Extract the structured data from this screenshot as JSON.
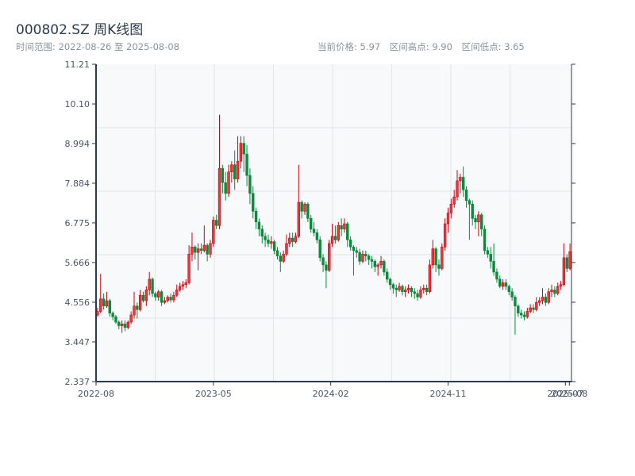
{
  "header": {
    "title": "000802.SZ 周K线图",
    "range_text": "时间范围: 2022-08-26 至 2025-08-08",
    "current_price": "当前价格: 5.97",
    "range_high": "区间高点: 9.90",
    "range_low": "区间低点: 3.65"
  },
  "colors": {
    "up": "#d0000f",
    "up_fill": "#e53a40",
    "down": "#0b8a3c",
    "axis": "#2c3a4b",
    "plot_bg": "#f7f9fb",
    "grid": "#e2e5ea"
  },
  "chart_data": {
    "type": "candlestick",
    "title": "000802.SZ 周K线图",
    "up_color": "red",
    "down_color": "green",
    "ylim": [
      2.337,
      11.21
    ],
    "y_ticks": [
      "11.21",
      "10.10",
      "8.994",
      "7.884",
      "6.775",
      "5.666",
      "4.556",
      "3.447",
      "2.337"
    ],
    "x_ticks": [
      {
        "label": "2022-08",
        "index": 0
      },
      {
        "label": "2023-05",
        "index": 38.5
      },
      {
        "label": "2024-02",
        "index": 77
      },
      {
        "label": "2024-11",
        "index": 115.5
      },
      {
        "label": "2025-07",
        "index": 154
      },
      {
        "label": "2025-08",
        "index": 155.3
      }
    ],
    "grid": true,
    "ohlc_fields": [
      "open",
      "close",
      "low",
      "high"
    ],
    "ohlc": [
      [
        4.2,
        4.3,
        4.15,
        4.4
      ],
      [
        4.3,
        4.65,
        4.25,
        5.35
      ],
      [
        4.65,
        4.45,
        4.35,
        4.8
      ],
      [
        4.45,
        4.6,
        4.4,
        4.85
      ],
      [
        4.6,
        4.25,
        4.15,
        4.65
      ],
      [
        4.25,
        4.15,
        4.05,
        4.3
      ],
      [
        4.15,
        4.0,
        3.95,
        4.2
      ],
      [
        4.0,
        3.9,
        3.8,
        4.05
      ],
      [
        3.9,
        3.95,
        3.7,
        4.05
      ],
      [
        3.95,
        3.85,
        3.75,
        4.05
      ],
      [
        3.85,
        4.0,
        3.8,
        4.05
      ],
      [
        4.0,
        4.2,
        3.95,
        4.3
      ],
      [
        4.2,
        4.45,
        4.1,
        4.85
      ],
      [
        4.45,
        4.35,
        4.1,
        4.55
      ],
      [
        4.35,
        4.75,
        4.3,
        4.9
      ],
      [
        4.75,
        4.6,
        4.55,
        4.85
      ],
      [
        4.6,
        4.9,
        4.45,
        5.0
      ],
      [
        4.9,
        5.2,
        4.75,
        5.4
      ],
      [
        5.2,
        4.8,
        4.7,
        5.25
      ],
      [
        4.8,
        4.7,
        4.6,
        4.85
      ],
      [
        4.7,
        4.85,
        4.6,
        4.9
      ],
      [
        4.85,
        4.55,
        4.45,
        4.9
      ],
      [
        4.55,
        4.6,
        4.5,
        4.7
      ],
      [
        4.6,
        4.7,
        4.55,
        4.75
      ],
      [
        4.7,
        4.62,
        4.55,
        4.8
      ],
      [
        4.62,
        4.75,
        4.55,
        4.85
      ],
      [
        4.75,
        4.9,
        4.7,
        5.05
      ],
      [
        4.9,
        5.0,
        4.85,
        5.1
      ],
      [
        5.0,
        5.05,
        4.9,
        5.15
      ],
      [
        5.05,
        5.1,
        4.95,
        5.2
      ],
      [
        5.1,
        5.9,
        5.05,
        6.15
      ],
      [
        5.9,
        6.1,
        5.7,
        6.5
      ],
      [
        6.1,
        5.95,
        5.75,
        6.15
      ],
      [
        5.95,
        6.05,
        5.45,
        6.2
      ],
      [
        6.05,
        6.0,
        5.9,
        6.2
      ],
      [
        6.0,
        6.15,
        5.95,
        6.7
      ],
      [
        6.15,
        5.9,
        5.7,
        6.2
      ],
      [
        5.9,
        6.2,
        5.8,
        6.3
      ],
      [
        6.2,
        6.85,
        6.1,
        6.95
      ],
      [
        6.85,
        6.7,
        6.6,
        7.0
      ],
      [
        6.7,
        8.3,
        6.6,
        9.8
      ],
      [
        8.3,
        7.9,
        7.6,
        8.4
      ],
      [
        7.9,
        7.6,
        7.4,
        8.2
      ],
      [
        7.6,
        8.2,
        7.5,
        8.4
      ],
      [
        8.2,
        8.4,
        7.9,
        8.5
      ],
      [
        8.4,
        8.0,
        7.7,
        8.8
      ],
      [
        8.0,
        8.5,
        7.9,
        9.2
      ],
      [
        8.5,
        9.0,
        8.3,
        9.2
      ],
      [
        9.0,
        8.7,
        8.2,
        9.2
      ],
      [
        8.7,
        8.1,
        7.8,
        8.95
      ],
      [
        8.1,
        7.6,
        7.3,
        8.3
      ],
      [
        7.6,
        7.1,
        6.9,
        7.8
      ],
      [
        7.1,
        6.8,
        6.6,
        7.2
      ],
      [
        6.8,
        6.6,
        6.4,
        6.9
      ],
      [
        6.6,
        6.4,
        6.2,
        6.7
      ],
      [
        6.4,
        6.3,
        6.1,
        6.5
      ],
      [
        6.3,
        6.2,
        6.1,
        6.45
      ],
      [
        6.2,
        6.25,
        6.05,
        6.4
      ],
      [
        6.25,
        6.0,
        5.9,
        6.3
      ],
      [
        6.0,
        5.85,
        5.75,
        6.1
      ],
      [
        5.85,
        5.7,
        5.4,
        5.95
      ],
      [
        5.7,
        5.9,
        5.65,
        6.0
      ],
      [
        5.9,
        6.2,
        5.85,
        6.45
      ],
      [
        6.2,
        6.35,
        6.1,
        6.5
      ],
      [
        6.35,
        6.25,
        6.1,
        6.5
      ],
      [
        6.25,
        6.4,
        6.2,
        6.5
      ],
      [
        6.4,
        7.35,
        6.35,
        8.4
      ],
      [
        7.35,
        7.1,
        6.9,
        7.4
      ],
      [
        7.1,
        7.3,
        7.0,
        7.35
      ],
      [
        7.3,
        6.9,
        6.8,
        7.35
      ],
      [
        6.9,
        6.6,
        6.5,
        7.0
      ],
      [
        6.6,
        6.5,
        6.4,
        6.8
      ],
      [
        6.5,
        6.3,
        6.2,
        6.6
      ],
      [
        6.3,
        5.8,
        5.7,
        6.4
      ],
      [
        5.8,
        5.6,
        5.4,
        5.9
      ],
      [
        5.6,
        5.45,
        4.95,
        5.7
      ],
      [
        5.45,
        6.2,
        5.4,
        6.3
      ],
      [
        6.2,
        6.4,
        6.1,
        6.75
      ],
      [
        6.4,
        6.3,
        6.2,
        6.7
      ],
      [
        6.3,
        6.7,
        6.25,
        6.8
      ],
      [
        6.7,
        6.6,
        6.4,
        6.9
      ],
      [
        6.6,
        6.75,
        6.5,
        6.9
      ],
      [
        6.75,
        6.3,
        6.1,
        6.8
      ],
      [
        6.3,
        6.1,
        6.0,
        6.4
      ],
      [
        6.1,
        6.0,
        5.3,
        6.15
      ],
      [
        6.0,
        5.95,
        5.8,
        6.1
      ],
      [
        5.95,
        5.7,
        5.6,
        6.05
      ],
      [
        5.7,
        5.9,
        5.65,
        6.0
      ],
      [
        5.9,
        5.85,
        5.7,
        6.0
      ],
      [
        5.85,
        5.75,
        5.6,
        5.9
      ],
      [
        5.75,
        5.7,
        5.5,
        5.85
      ],
      [
        5.7,
        5.55,
        5.4,
        5.75
      ],
      [
        5.55,
        5.6,
        5.3,
        5.65
      ],
      [
        5.6,
        5.7,
        5.5,
        5.85
      ],
      [
        5.7,
        5.4,
        5.3,
        5.75
      ],
      [
        5.4,
        5.2,
        5.1,
        5.5
      ],
      [
        5.2,
        5.05,
        4.9,
        5.25
      ],
      [
        5.05,
        4.95,
        4.8,
        5.1
      ],
      [
        4.95,
        4.9,
        4.7,
        5.05
      ],
      [
        4.9,
        5.0,
        4.85,
        5.1
      ],
      [
        5.0,
        4.85,
        4.75,
        5.05
      ],
      [
        4.85,
        4.9,
        4.7,
        5.0
      ],
      [
        4.9,
        4.95,
        4.8,
        5.05
      ],
      [
        4.95,
        4.85,
        4.7,
        5.0
      ],
      [
        4.85,
        4.8,
        4.65,
        4.95
      ],
      [
        4.8,
        4.7,
        4.6,
        4.9
      ],
      [
        4.7,
        4.9,
        4.65,
        5.0
      ],
      [
        4.9,
        4.95,
        4.8,
        5.05
      ],
      [
        4.95,
        4.85,
        4.75,
        5.05
      ],
      [
        4.85,
        5.6,
        4.8,
        5.75
      ],
      [
        5.6,
        6.05,
        5.5,
        6.3
      ],
      [
        6.05,
        5.6,
        5.4,
        6.1
      ],
      [
        5.6,
        5.5,
        5.3,
        5.75
      ],
      [
        5.5,
        6.1,
        5.45,
        6.2
      ],
      [
        6.1,
        6.75,
        6.0,
        6.9
      ],
      [
        6.75,
        7.05,
        6.5,
        7.2
      ],
      [
        7.05,
        7.3,
        6.9,
        7.45
      ],
      [
        7.3,
        7.5,
        7.2,
        7.7
      ],
      [
        7.5,
        7.95,
        7.4,
        8.25
      ],
      [
        7.95,
        8.05,
        7.6,
        8.15
      ],
      [
        8.05,
        7.7,
        7.5,
        8.35
      ],
      [
        7.7,
        7.4,
        7.2,
        7.8
      ],
      [
        7.4,
        7.3,
        6.3,
        7.45
      ],
      [
        7.3,
        6.9,
        6.7,
        7.4
      ],
      [
        6.9,
        6.8,
        6.6,
        7.0
      ],
      [
        6.8,
        7.0,
        6.4,
        7.1
      ],
      [
        7.0,
        6.6,
        6.4,
        7.05
      ],
      [
        6.6,
        6.0,
        5.9,
        6.7
      ],
      [
        6.0,
        5.9,
        5.8,
        6.1
      ],
      [
        5.9,
        5.7,
        5.5,
        6.1
      ],
      [
        5.7,
        5.4,
        5.3,
        6.2
      ],
      [
        5.4,
        5.2,
        5.1,
        5.5
      ],
      [
        5.2,
        5.0,
        4.95,
        5.3
      ],
      [
        5.0,
        5.1,
        4.9,
        5.2
      ],
      [
        5.1,
        5.0,
        4.9,
        5.2
      ],
      [
        5.0,
        4.85,
        4.75,
        5.05
      ],
      [
        4.85,
        4.7,
        4.6,
        4.95
      ],
      [
        4.7,
        4.45,
        3.65,
        4.75
      ],
      [
        4.45,
        4.25,
        4.15,
        4.5
      ],
      [
        4.25,
        4.2,
        4.1,
        4.35
      ],
      [
        4.2,
        4.15,
        4.05,
        4.3
      ],
      [
        4.15,
        4.3,
        4.1,
        4.4
      ],
      [
        4.3,
        4.4,
        4.25,
        4.5
      ],
      [
        4.4,
        4.35,
        4.25,
        4.5
      ],
      [
        4.35,
        4.55,
        4.3,
        4.7
      ],
      [
        4.55,
        4.6,
        4.45,
        4.7
      ],
      [
        4.6,
        4.7,
        4.5,
        4.95
      ],
      [
        4.7,
        4.55,
        4.45,
        4.8
      ],
      [
        4.55,
        4.85,
        4.5,
        4.95
      ],
      [
        4.85,
        4.9,
        4.7,
        5.05
      ],
      [
        4.9,
        4.8,
        4.7,
        5.0
      ],
      [
        4.8,
        5.0,
        4.75,
        5.1
      ],
      [
        5.0,
        5.05,
        4.9,
        5.15
      ],
      [
        5.05,
        5.8,
        5.0,
        6.2
      ],
      [
        5.8,
        5.5,
        5.4,
        5.9
      ],
      [
        5.5,
        5.97,
        5.45,
        6.2
      ]
    ]
  }
}
